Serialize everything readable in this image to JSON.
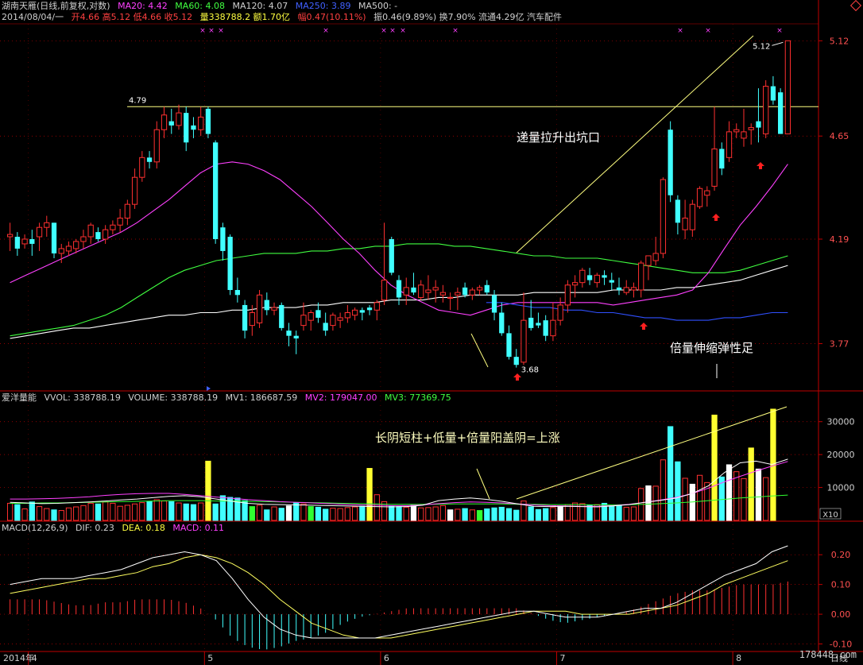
{
  "header": {
    "line1": {
      "title": "湖南天雁(日线,前复权,对数)",
      "ma20": "MA20: 4.42",
      "ma60": "MA60: 4.08",
      "ma120": "MA120: 4.07",
      "ma250": "MA250: 3.89",
      "ma500": "MA500: -"
    },
    "line2": {
      "date": "2014/08/04/一",
      "ohlc": "开4.66 高5.12 低4.66 收5.12",
      "amount": "量338788.2 额1.70亿",
      "change": "幅0.47(10.11%)",
      "rest": "振0.46(9.89%) 换7.90% 流通4.29亿 汽车配件"
    }
  },
  "volume_header": {
    "name": "爱洋量能",
    "vvol": "VVOL: 338788.19",
    "volume": "VOLUME: 338788.19",
    "mv1": "MV1: 186687.59",
    "mv2": "MV2: 179047.00",
    "mv3": "MV3: 77369.75"
  },
  "macd_header": {
    "name": "MACD(12,26,9)",
    "dif": "DIF: 0.23",
    "dea": "DEA: 0.18",
    "macd": "MACD: 0.11"
  },
  "annotations": {
    "a1": "递量拉升出坑口",
    "a2": "倍量伸缩弹性足",
    "a3": "长阴短柱+低量+倍量阳盖阴=上涨",
    "hline_label": "4.79",
    "high_label": "5.12",
    "low_label": "3.68"
  },
  "footer": {
    "year": "2014年",
    "period": "日线",
    "watermark": "178448.com",
    "x10": "X10"
  },
  "colors": {
    "up": "#ff3030",
    "down": "#40ffff",
    "ma20": "#ff40ff",
    "ma60": "#40ff40",
    "ma120": "#ffffff",
    "ma250": "#3050ff"
  },
  "chart_data": [
    {
      "type": "candlestick",
      "ylim": [
        3.6,
        5.2
      ],
      "yticks": [
        "5.12",
        "4.65",
        "4.19",
        "3.77"
      ],
      "xticks": [
        "4",
        "5",
        "6",
        "7",
        "8"
      ],
      "hline": 4.79,
      "ohlc": [
        [
          4.2,
          4.26,
          4.14,
          4.21
        ],
        [
          4.2,
          4.22,
          4.12,
          4.15
        ],
        [
          4.17,
          4.21,
          4.15,
          4.19
        ],
        [
          4.19,
          4.23,
          4.12,
          4.17
        ],
        [
          4.2,
          4.26,
          4.14,
          4.24
        ],
        [
          4.24,
          4.29,
          4.2,
          4.26
        ],
        [
          4.26,
          4.26,
          4.11,
          4.13
        ],
        [
          4.13,
          4.17,
          4.09,
          4.15
        ],
        [
          4.14,
          4.18,
          4.12,
          4.16
        ],
        [
          4.15,
          4.19,
          4.13,
          4.18
        ],
        [
          4.18,
          4.23,
          4.15,
          4.2
        ],
        [
          4.2,
          4.26,
          4.17,
          4.25
        ],
        [
          4.22,
          4.24,
          4.18,
          4.19
        ],
        [
          4.19,
          4.25,
          4.17,
          4.23
        ],
        [
          4.23,
          4.27,
          4.21,
          4.25
        ],
        [
          4.25,
          4.32,
          4.22,
          4.28
        ],
        [
          4.28,
          4.36,
          4.25,
          4.34
        ],
        [
          4.34,
          4.5,
          4.32,
          4.46
        ],
        [
          4.46,
          4.58,
          4.44,
          4.55
        ],
        [
          4.55,
          4.58,
          4.5,
          4.53
        ],
        [
          4.53,
          4.72,
          4.5,
          4.68
        ],
        [
          4.68,
          4.79,
          4.64,
          4.75
        ],
        [
          4.72,
          4.78,
          4.66,
          4.7
        ],
        [
          4.7,
          4.8,
          4.68,
          4.76
        ],
        [
          4.76,
          4.79,
          4.58,
          4.62
        ],
        [
          4.7,
          4.74,
          4.64,
          4.68
        ],
        [
          4.68,
          4.79,
          4.65,
          4.74
        ],
        [
          4.78,
          4.79,
          4.64,
          4.66
        ],
        [
          4.62,
          4.63,
          4.17,
          4.19
        ],
        [
          4.24,
          4.26,
          4.1,
          4.14
        ],
        [
          4.2,
          4.21,
          3.96,
          3.98
        ],
        [
          3.98,
          4.03,
          3.93,
          3.96
        ],
        [
          3.92,
          3.94,
          3.79,
          3.82
        ],
        [
          3.84,
          3.92,
          3.8,
          3.89
        ],
        [
          3.85,
          3.98,
          3.83,
          3.96
        ],
        [
          3.94,
          3.97,
          3.88,
          3.9
        ],
        [
          3.9,
          3.93,
          3.88,
          3.91
        ],
        [
          3.92,
          3.93,
          3.82,
          3.83
        ],
        [
          3.82,
          3.85,
          3.76,
          3.8
        ],
        [
          3.8,
          3.82,
          3.73,
          3.79
        ],
        [
          3.84,
          3.93,
          3.82,
          3.88
        ],
        [
          3.86,
          3.9,
          3.82,
          3.89
        ],
        [
          3.9,
          3.93,
          3.85,
          3.87
        ],
        [
          3.85,
          3.89,
          3.8,
          3.82
        ],
        [
          3.84,
          3.89,
          3.82,
          3.88
        ],
        [
          3.86,
          3.89,
          3.83,
          3.87
        ],
        [
          3.87,
          3.92,
          3.85,
          3.89
        ],
        [
          3.88,
          3.91,
          3.86,
          3.9
        ],
        [
          3.9,
          3.91,
          3.86,
          3.89
        ],
        [
          3.91,
          3.92,
          3.88,
          3.9
        ],
        [
          3.9,
          3.94,
          3.86,
          3.93
        ],
        [
          3.94,
          4.26,
          3.92,
          4.02
        ],
        [
          4.19,
          4.2,
          4.04,
          4.05
        ],
        [
          4.02,
          4.04,
          3.92,
          3.95
        ],
        [
          3.96,
          4.03,
          3.92,
          3.99
        ],
        [
          3.99,
          4.05,
          3.96,
          3.97
        ],
        [
          3.95,
          4.02,
          3.94,
          4.0
        ],
        [
          3.97,
          4.04,
          3.94,
          3.98
        ],
        [
          3.98,
          4.02,
          3.93,
          3.99
        ],
        [
          3.96,
          4.0,
          3.93,
          3.97
        ],
        [
          3.95,
          3.97,
          3.9,
          3.95
        ],
        [
          3.96,
          3.99,
          3.9,
          3.97
        ],
        [
          3.99,
          4.01,
          3.95,
          3.96
        ],
        [
          3.96,
          3.99,
          3.94,
          3.98
        ],
        [
          3.98,
          4.0,
          3.96,
          3.99
        ],
        [
          4.0,
          4.02,
          3.96,
          3.97
        ],
        [
          3.96,
          3.98,
          3.86,
          3.89
        ],
        [
          3.89,
          3.93,
          3.8,
          3.81
        ],
        [
          3.81,
          3.84,
          3.71,
          3.72
        ],
        [
          3.72,
          3.75,
          3.68,
          3.69
        ],
        [
          3.7,
          3.97,
          3.69,
          3.86
        ],
        [
          3.87,
          3.94,
          3.82,
          3.83
        ],
        [
          3.85,
          3.89,
          3.83,
          3.84
        ],
        [
          3.86,
          3.88,
          3.78,
          3.8
        ],
        [
          3.8,
          3.93,
          3.78,
          3.86
        ],
        [
          3.86,
          3.95,
          3.84,
          3.92
        ],
        [
          3.92,
          4.02,
          3.89,
          4.0
        ],
        [
          4.0,
          4.04,
          3.95,
          4.01
        ],
        [
          4.01,
          4.07,
          3.99,
          4.06
        ],
        [
          4.04,
          4.07,
          4.0,
          4.02
        ],
        [
          4.01,
          4.05,
          3.99,
          4.04
        ],
        [
          4.04,
          4.06,
          4.0,
          4.03
        ],
        [
          4.02,
          4.05,
          3.98,
          4.01
        ],
        [
          3.99,
          4.03,
          3.96,
          3.98
        ],
        [
          3.97,
          4.02,
          3.96,
          3.99
        ],
        [
          3.98,
          4.01,
          3.95,
          3.99
        ],
        [
          3.98,
          4.1,
          3.95,
          4.09
        ],
        [
          4.08,
          4.12,
          4.02,
          4.12
        ],
        [
          4.1,
          4.2,
          4.08,
          4.13
        ],
        [
          4.13,
          4.46,
          4.11,
          4.45
        ],
        [
          4.68,
          4.72,
          4.35,
          4.38
        ],
        [
          4.36,
          4.38,
          4.21,
          4.26
        ],
        [
          4.23,
          4.36,
          4.19,
          4.28
        ],
        [
          4.23,
          4.36,
          4.2,
          4.34
        ],
        [
          4.33,
          4.42,
          4.32,
          4.41
        ],
        [
          4.38,
          4.42,
          4.33,
          4.4
        ],
        [
          4.42,
          4.79,
          4.4,
          4.59
        ],
        [
          4.59,
          4.62,
          4.47,
          4.5
        ],
        [
          4.55,
          4.72,
          4.53,
          4.67
        ],
        [
          4.67,
          4.71,
          4.64,
          4.68
        ],
        [
          4.64,
          4.78,
          4.6,
          4.67
        ],
        [
          4.68,
          4.71,
          4.61,
          4.69
        ],
        [
          4.72,
          4.88,
          4.62,
          4.69
        ],
        [
          4.66,
          4.92,
          4.64,
          4.89
        ],
        [
          4.89,
          4.94,
          4.8,
          4.82
        ],
        [
          4.86,
          4.88,
          4.66,
          4.66
        ],
        [
          4.66,
          5.12,
          4.66,
          5.12
        ]
      ],
      "ma20": [
        4.01,
        4.04,
        4.07,
        4.1,
        4.13,
        4.16,
        4.19,
        4.22,
        4.26,
        4.31,
        4.36,
        4.42,
        4.48,
        4.52,
        4.53,
        4.52,
        4.49,
        4.45,
        4.39,
        4.33,
        4.26,
        4.19,
        4.13,
        4.06,
        4.0,
        3.96,
        3.93,
        3.9,
        3.89,
        3.88,
        3.9,
        3.92,
        3.93,
        3.93,
        3.93,
        3.93,
        3.93,
        3.93,
        3.92,
        3.93,
        3.94,
        3.95,
        3.96,
        3.98,
        4.05,
        4.15,
        4.25,
        4.33,
        4.42,
        4.52
      ],
      "ma60": [
        3.8,
        3.81,
        3.82,
        3.83,
        3.84,
        3.86,
        3.88,
        3.91,
        3.95,
        3.99,
        4.03,
        4.06,
        4.08,
        4.1,
        4.11,
        4.12,
        4.13,
        4.13,
        4.13,
        4.14,
        4.14,
        4.15,
        4.15,
        4.16,
        4.16,
        4.17,
        4.17,
        4.17,
        4.16,
        4.16,
        4.15,
        4.14,
        4.13,
        4.12,
        4.12,
        4.11,
        4.11,
        4.11,
        4.1,
        4.09,
        4.08,
        4.07,
        4.06,
        4.05,
        4.05,
        4.05,
        4.06,
        4.08,
        4.1,
        4.12
      ],
      "ma120": [
        3.79,
        3.8,
        3.81,
        3.82,
        3.83,
        3.83,
        3.84,
        3.85,
        3.86,
        3.87,
        3.88,
        3.88,
        3.89,
        3.89,
        3.9,
        3.9,
        3.91,
        3.91,
        3.91,
        3.92,
        3.92,
        3.93,
        3.93,
        3.93,
        3.94,
        3.94,
        3.94,
        3.95,
        3.95,
        3.96,
        3.96,
        3.96,
        3.96,
        3.97,
        3.97,
        3.97,
        3.97,
        3.97,
        3.98,
        3.98,
        3.98,
        3.98,
        3.99,
        3.99,
        4.0,
        4.01,
        4.02,
        4.04,
        4.06,
        4.08
      ],
      "ma250": [
        null,
        null,
        null,
        null,
        null,
        null,
        null,
        null,
        null,
        null,
        null,
        null,
        null,
        null,
        null,
        null,
        null,
        null,
        null,
        null,
        null,
        null,
        null,
        null,
        null,
        null,
        null,
        null,
        null,
        null,
        3.93,
        3.93,
        3.92,
        3.91,
        3.91,
        3.9,
        3.9,
        3.89,
        3.89,
        3.88,
        3.87,
        3.87,
        3.86,
        3.86,
        3.86,
        3.87,
        3.87,
        3.88,
        3.89,
        3.89
      ]
    },
    {
      "type": "bar",
      "title": "爱洋量能",
      "ylim": [
        0,
        35000
      ],
      "yticks": [
        "30000",
        "20000",
        "10000"
      ],
      "unit": "X10",
      "values": [
        5200,
        4800,
        3500,
        5600,
        4200,
        3600,
        3200,
        3000,
        3800,
        4100,
        4500,
        5200,
        5000,
        5600,
        5200,
        4300,
        4600,
        5000,
        5400,
        5800,
        6300,
        5900,
        5700,
        5300,
        5000,
        4800,
        5300,
        18000,
        5000,
        7500,
        7000,
        6800,
        6000,
        4200,
        4600,
        3200,
        4100,
        3700,
        4400,
        5400,
        5000,
        4200,
        4000,
        3400,
        3700,
        3600,
        3900,
        4100,
        4300,
        15800,
        7800,
        5700,
        4300,
        4200,
        4000,
        4600,
        3800,
        3900,
        4100,
        4500,
        3200,
        3400,
        3600,
        3200,
        3000,
        3500,
        3800,
        4000,
        3600,
        3100,
        5900,
        4100,
        3300,
        3600,
        3900,
        4300,
        4800,
        5300,
        5100,
        4700,
        4800,
        5200,
        4500,
        4500,
        4000,
        4100,
        9700,
        10500,
        10400,
        18400,
        28500,
        17800,
        12800,
        11000,
        13700,
        11500,
        32000,
        13200,
        16900,
        14800,
        12700,
        22000,
        15600,
        13000,
        33800
      ],
      "mv1": [
        5500,
        5300,
        5100,
        5200,
        5400,
        5600,
        5900,
        6200,
        6500,
        6900,
        7300,
        7500,
        7200,
        6500,
        5800,
        5200,
        4900,
        4800,
        4700,
        4600,
        4500,
        4400,
        4300,
        4200,
        4100,
        4200,
        4600,
        6000,
        6500,
        6800,
        6400,
        5800,
        5000,
        4300,
        4200,
        4300,
        4200,
        4100,
        4400,
        4800,
        5500,
        6100,
        6800,
        8200,
        10500,
        14500,
        17500,
        18000,
        17000,
        18600
      ],
      "mv2": [
        6500,
        6500,
        6600,
        6700,
        6900,
        7200,
        7600,
        7900,
        8100,
        8200,
        8200,
        7900,
        7500,
        7100,
        6700,
        6300,
        6000,
        5700,
        5500,
        5300,
        5100,
        4900,
        4700,
        4600,
        4500,
        4500,
        4700,
        5100,
        5400,
        5600,
        5500,
        5300,
        5000,
        4700,
        4500,
        4400,
        4300,
        4300,
        4500,
        4900,
        5500,
        6200,
        7000,
        8200,
        9800,
        11700,
        13400,
        15000,
        16500,
        17900
      ],
      "mv3": [
        5200,
        5200,
        5300,
        5300,
        5400,
        5500,
        5600,
        5700,
        5800,
        5900,
        6000,
        6000,
        6000,
        5900,
        5900,
        5800,
        5700,
        5600,
        5500,
        5400,
        5300,
        5200,
        5100,
        5000,
        4900,
        4900,
        4900,
        4900,
        5000,
        5000,
        5000,
        5000,
        4900,
        4900,
        4800,
        4800,
        4800,
        4700,
        4700,
        4800,
        4900,
        5100,
        5300,
        5600,
        6000,
        6400,
        6800,
        7100,
        7400,
        7700
      ]
    },
    {
      "type": "macd",
      "ylim": [
        -0.12,
        0.27
      ],
      "yticks": [
        "0.20",
        "0.10",
        "0.00",
        "-0.10"
      ],
      "dif": [
        0.1,
        0.11,
        0.12,
        0.12,
        0.12,
        0.13,
        0.14,
        0.15,
        0.17,
        0.19,
        0.2,
        0.21,
        0.2,
        0.18,
        0.12,
        0.05,
        -0.01,
        -0.05,
        -0.07,
        -0.08,
        -0.08,
        -0.08,
        -0.08,
        -0.08,
        -0.07,
        -0.06,
        -0.05,
        -0.04,
        -0.03,
        -0.02,
        -0.01,
        0.0,
        0.01,
        0.01,
        0.0,
        -0.01,
        -0.01,
        -0.01,
        0.0,
        0.01,
        0.02,
        0.02,
        0.04,
        0.07,
        0.1,
        0.13,
        0.15,
        0.17,
        0.21,
        0.23
      ],
      "dea": [
        0.07,
        0.08,
        0.09,
        0.1,
        0.11,
        0.12,
        0.12,
        0.13,
        0.14,
        0.16,
        0.17,
        0.19,
        0.2,
        0.19,
        0.17,
        0.14,
        0.1,
        0.05,
        0.01,
        -0.03,
        -0.05,
        -0.07,
        -0.08,
        -0.08,
        -0.08,
        -0.07,
        -0.06,
        -0.05,
        -0.04,
        -0.03,
        -0.02,
        -0.01,
        0.0,
        0.01,
        0.01,
        0.01,
        0.0,
        0.0,
        0.0,
        0.0,
        0.01,
        0.02,
        0.03,
        0.05,
        0.07,
        0.1,
        0.12,
        0.14,
        0.16,
        0.18
      ],
      "macd": [
        0.05,
        0.05,
        0.05,
        0.04,
        0.03,
        0.03,
        0.04,
        0.04,
        0.05,
        0.05,
        0.05,
        0.04,
        0.02,
        -0.02,
        -0.08,
        -0.11,
        -0.12,
        -0.11,
        -0.09,
        -0.08,
        -0.06,
        -0.03,
        -0.01,
        0.0,
        0.01,
        0.02,
        0.02,
        0.02,
        0.02,
        0.02,
        0.02,
        0.02,
        0.02,
        0.0,
        -0.02,
        -0.03,
        -0.02,
        -0.01,
        0.0,
        0.01,
        0.03,
        0.05,
        0.07,
        0.08,
        0.08,
        0.09,
        0.1,
        0.1,
        0.1,
        0.11
      ]
    }
  ]
}
